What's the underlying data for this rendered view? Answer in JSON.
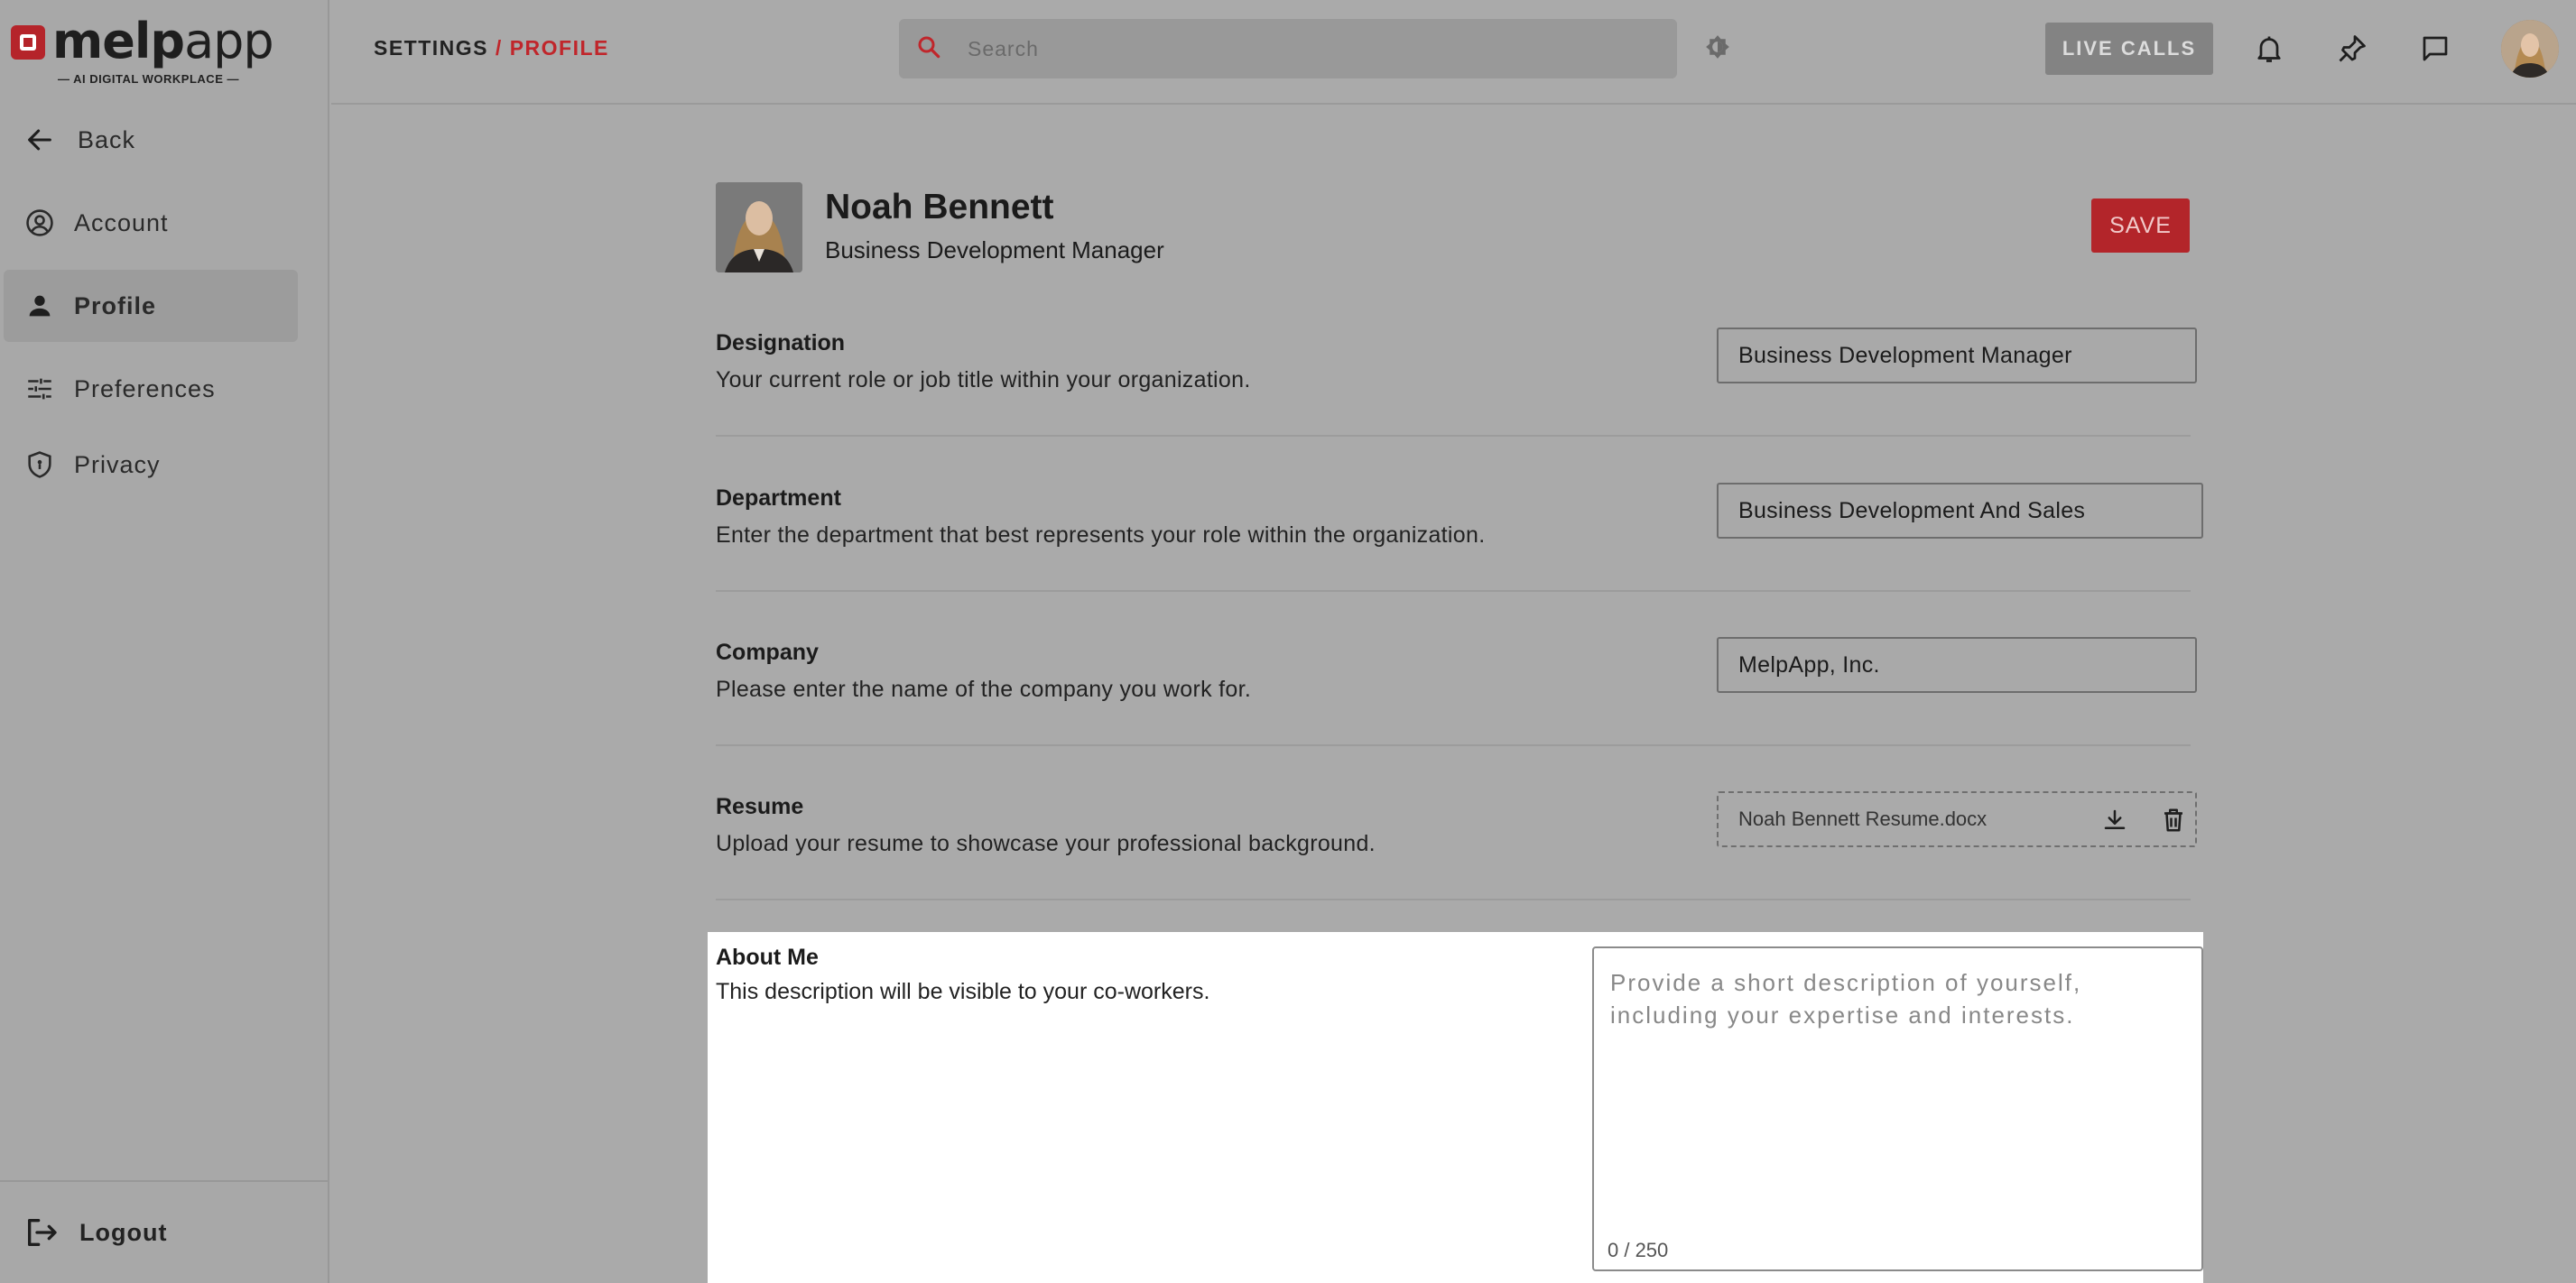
{
  "app": {
    "logo_text": "melp",
    "logo_text2": "app",
    "logo_tagline": "— AI DIGITAL WORKPLACE —",
    "brand_color": "#b3252a"
  },
  "sidebar": {
    "back_label": "Back",
    "items": [
      {
        "label": "Account",
        "icon": "account-circle-icon"
      },
      {
        "label": "Profile",
        "icon": "person-icon",
        "active": true
      },
      {
        "label": "Preferences",
        "icon": "sliders-icon"
      },
      {
        "label": "Privacy",
        "icon": "shield-icon"
      }
    ],
    "logout_label": "Logout"
  },
  "header": {
    "crumb_root": "SETTINGS",
    "crumb_sep": "/",
    "crumb_current": "PROFILE",
    "search_placeholder": "Search",
    "live_calls_label": "LIVE CALLS"
  },
  "profile": {
    "name": "Noah Bennett",
    "role": "Business Development Manager",
    "save_label": "SAVE"
  },
  "fields": {
    "designation": {
      "label": "Designation",
      "desc": "Your current role or job title within your organization.",
      "value": "Business Development Manager"
    },
    "department": {
      "label": "Department",
      "desc": "Enter the department that best represents your role within the organization.",
      "value": "Business Development And Sales"
    },
    "company": {
      "label": "Company",
      "desc": "Please enter the name of the company you work for.",
      "value": "MelpApp, Inc."
    },
    "resume": {
      "label": "Resume",
      "desc": "Upload your resume to showcase your professional background.",
      "file_name": "Noah Bennett Resume.docx"
    },
    "about": {
      "label": "About Me",
      "desc": "This description will be visible to your co-workers.",
      "placeholder": "Provide a short description of yourself, including your expertise and interests.",
      "counter": "0 / 250"
    }
  }
}
